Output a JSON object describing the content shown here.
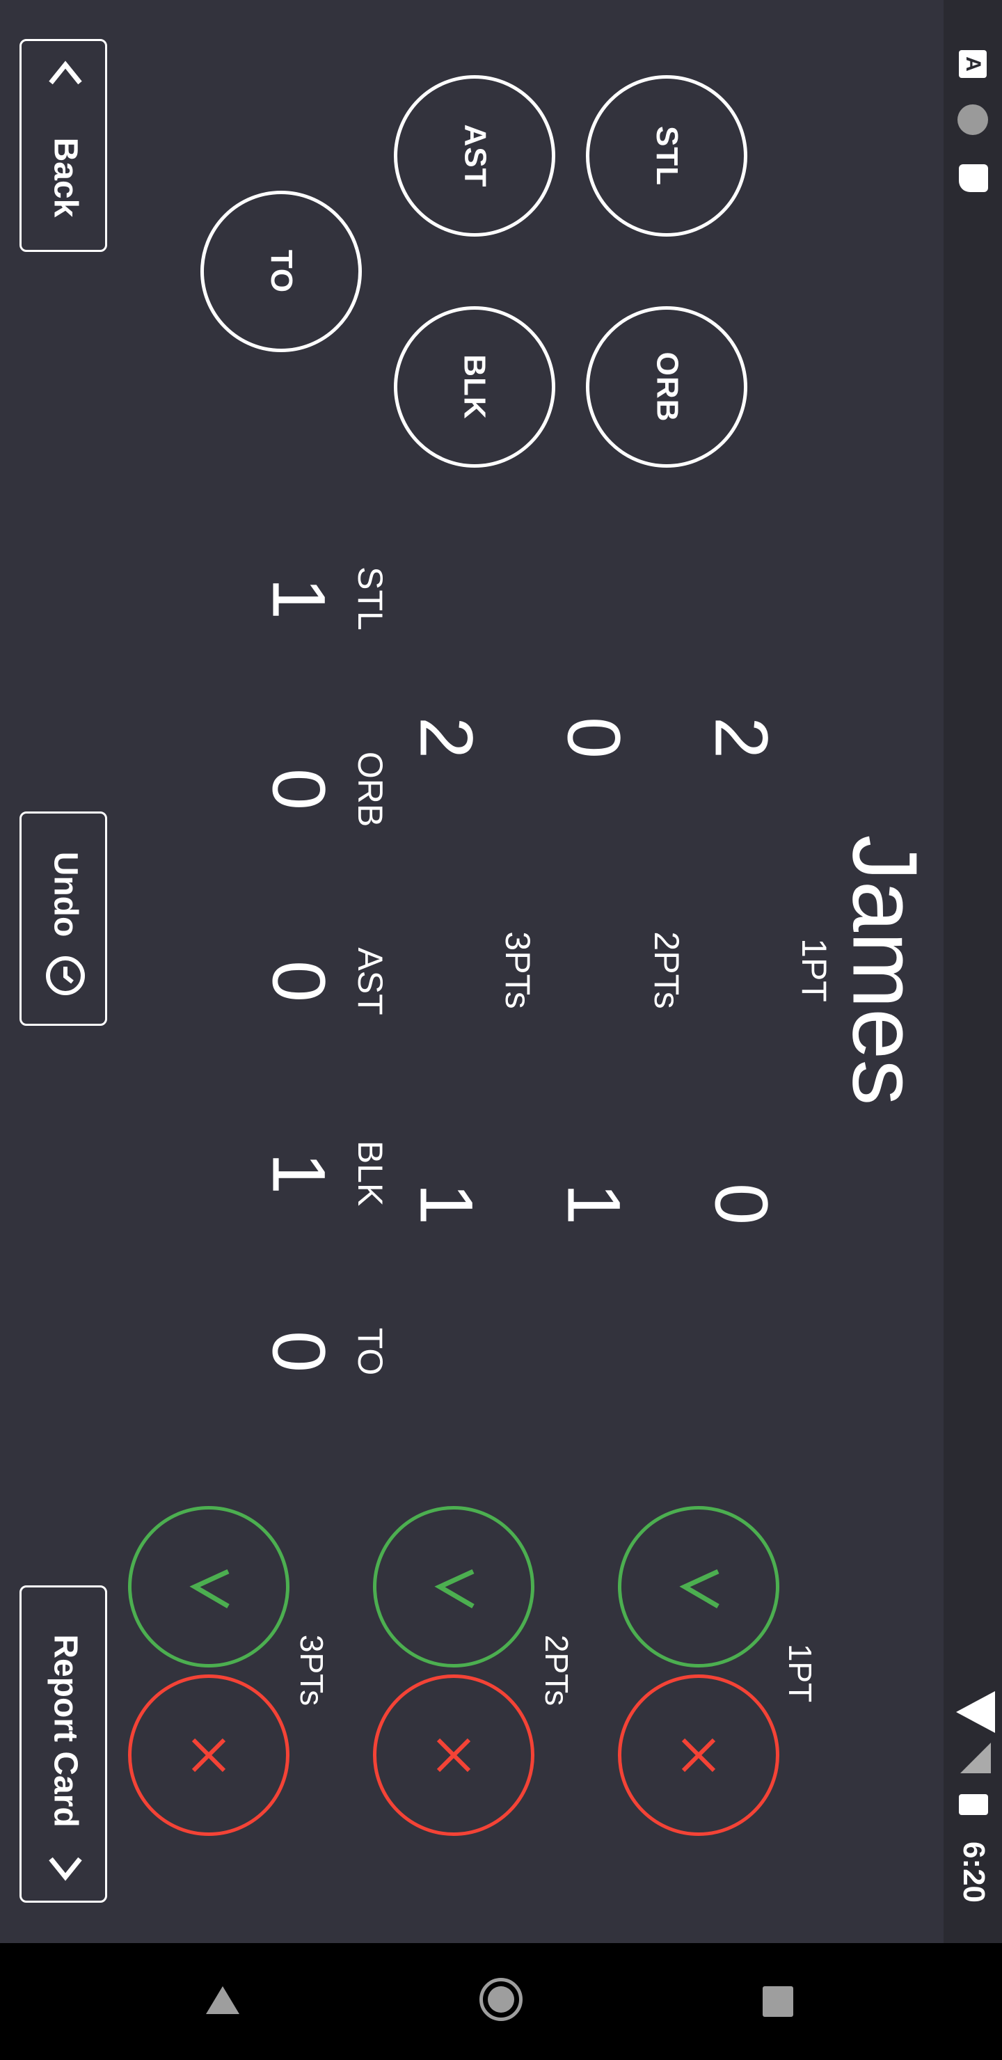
{
  "player_name": "James",
  "nav": {
    "back": "Back",
    "undo": "Undo",
    "report_card": "Report Card"
  },
  "status_bar": {
    "time": "6:20"
  },
  "stat_buttons": {
    "stl": "STL",
    "ast": "AST",
    "orb": "ORB",
    "blk": "BLK",
    "to": "TO"
  },
  "shooting": {
    "columns": [
      "1PT",
      "2PTs",
      "3PTs"
    ],
    "made": {
      "1PT": "2",
      "2PTs": "0",
      "3PTs": "2"
    },
    "missed": {
      "1PT": "0",
      "2PTs": "1",
      "3PTs": "1"
    }
  },
  "other_stats": {
    "labels": {
      "stl": "STL",
      "orb": "ORB",
      "ast": "AST",
      "blk": "BLK",
      "to": "TO"
    },
    "values": {
      "stl": "1",
      "orb": "0",
      "ast": "0",
      "blk": "1",
      "to": "0"
    }
  },
  "shot_entry": {
    "labels": {
      "one": "1PT",
      "two": "2PTs",
      "three": "3PTs"
    },
    "make_icon": "check-icon",
    "miss_icon": "x-icon"
  },
  "colors": {
    "background": "#33333d",
    "make": "#4caf50",
    "miss": "#f44336"
  }
}
